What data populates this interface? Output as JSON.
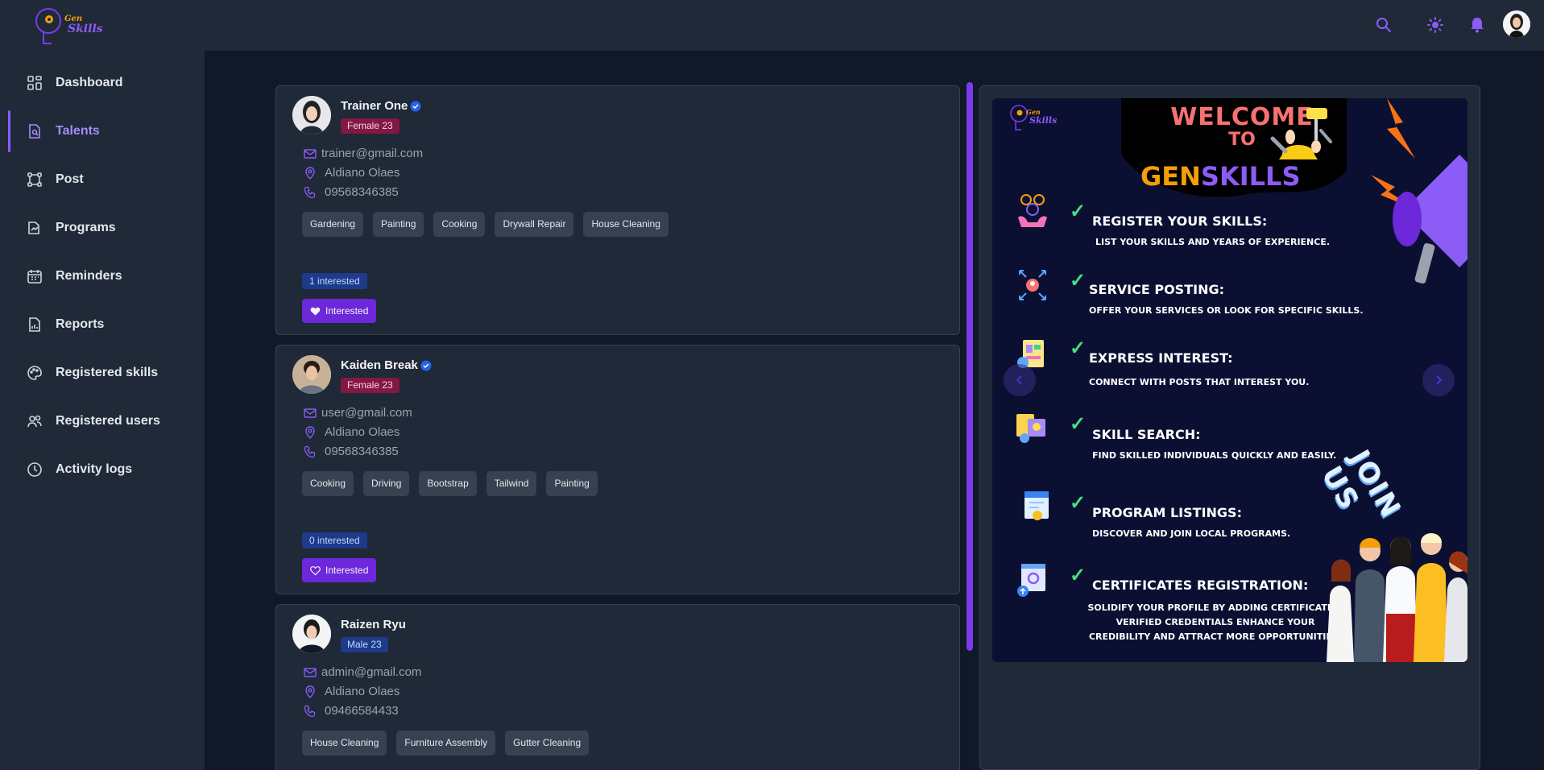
{
  "app": {
    "logo_top": "Gen",
    "logo_bottom": "Skills"
  },
  "header": {
    "icons": [
      "search-icon",
      "sun-icon",
      "bell-icon",
      "user-avatar"
    ],
    "accent": "#8b5cf6"
  },
  "sidebar": {
    "items": [
      {
        "label": "Dashboard",
        "icon": "dashboard-icon",
        "active": false
      },
      {
        "label": "Talents",
        "icon": "talents-icon",
        "active": true
      },
      {
        "label": "Post",
        "icon": "post-icon",
        "active": false
      },
      {
        "label": "Programs",
        "icon": "programs-icon",
        "active": false
      },
      {
        "label": "Reminders",
        "icon": "calendar-icon",
        "active": false
      },
      {
        "label": "Reports",
        "icon": "reports-icon",
        "active": false
      },
      {
        "label": "Registered skills",
        "icon": "palette-icon",
        "active": false
      },
      {
        "label": "Registered users",
        "icon": "users-icon",
        "active": false
      },
      {
        "label": "Activity logs",
        "icon": "clock-icon",
        "active": false
      }
    ]
  },
  "talents": [
    {
      "name": "Trainer One",
      "verified": true,
      "gender_age": "Female 23",
      "email": "trainer@gmail.com",
      "location": "Aldiano Olaes",
      "phone": "09568346385",
      "skills": [
        "Gardening",
        "Painting",
        "Cooking",
        "Drywall Repair",
        "House Cleaning"
      ],
      "interested_count": "1 interested",
      "interest_button": "Interested",
      "interested_filled": true
    },
    {
      "name": "Kaiden Break",
      "verified": true,
      "gender_age": "Female 23",
      "email": "user@gmail.com",
      "location": "Aldiano Olaes",
      "phone": "09568346385",
      "skills": [
        "Cooking",
        "Driving",
        "Bootstrap",
        "Tailwind",
        "Painting"
      ],
      "interested_count": "0 interested",
      "interest_button": "Interested",
      "interested_filled": false
    },
    {
      "name": "Raizen Ryu",
      "verified": false,
      "gender_age": "Male 23",
      "email": "admin@gmail.com",
      "location": "Aldiano Olaes",
      "phone": "09466584433",
      "skills": [
        "House Cleaning",
        "Furniture Assembly",
        "Gutter Cleaning"
      ]
    }
  ],
  "banner": {
    "logo_top": "Gen",
    "logo_bottom": "Skills",
    "welcome": "WELCOME",
    "to": "TO",
    "title_gen": "GEN",
    "title_skills": "SKILLS",
    "join_us": "JOIN US",
    "features": [
      {
        "title": "REGISTER YOUR SKILLS:",
        "desc": "LIST YOUR SKILLS AND YEARS OF EXPERIENCE."
      },
      {
        "title": "SERVICE POSTING:",
        "desc": "OFFER YOUR SERVICES OR LOOK FOR SPECIFIC SKILLS."
      },
      {
        "title": "EXPRESS INTEREST:",
        "desc": "CONNECT WITH POSTS THAT INTEREST YOU."
      },
      {
        "title": "SKILL SEARCH:",
        "desc": "FIND SKILLED INDIVIDUALS QUICKLY AND EASILY."
      },
      {
        "title": "PROGRAM LISTINGS:",
        "desc": "DISCOVER AND JOIN LOCAL PROGRAMS."
      },
      {
        "title": "CERTIFICATES REGISTRATION:",
        "desc": "SOLIDIFY YOUR PROFILE BY ADDING CERTIFICATES. VERIFIED CREDENTIALS ENHANCE YOUR CREDIBILITY AND ATTRACT MORE OPPORTUNITIES."
      }
    ]
  }
}
